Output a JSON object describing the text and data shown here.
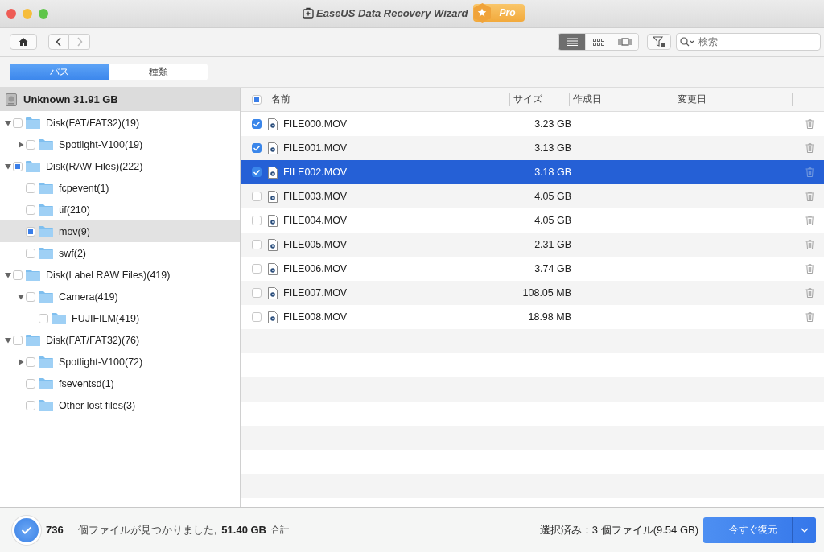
{
  "window": {
    "title": "EaseUS Data Recovery Wizard",
    "badge": "Pro"
  },
  "toolbar": {
    "views": [
      {
        "kind": "list",
        "selected": true
      },
      {
        "kind": "grid",
        "selected": false
      },
      {
        "kind": "cover",
        "selected": false
      }
    ],
    "search": {
      "placeholder": "検索"
    }
  },
  "tabs": [
    {
      "label": "パス",
      "selected": true
    },
    {
      "label": "種類",
      "selected": false
    }
  ],
  "drive": {
    "label": "Unknown 31.91 GB"
  },
  "tree": [
    {
      "label": "Disk(FAT/FAT32)(19)",
      "expanded": true,
      "partial": false,
      "selected": false,
      "children": [
        {
          "label": "Spotlight-V100(19)",
          "expanded": false,
          "partial": false,
          "selected": false
        }
      ]
    },
    {
      "label": "Disk(RAW Files)(222)",
      "expanded": true,
      "partial": true,
      "selected": false,
      "children": [
        {
          "label": "fcpevent(1)",
          "partial": false,
          "selected": false
        },
        {
          "label": "tif(210)",
          "partial": false,
          "selected": false
        },
        {
          "label": "mov(9)",
          "partial": true,
          "selected": true
        },
        {
          "label": "swf(2)",
          "partial": false,
          "selected": false
        }
      ]
    },
    {
      "label": "Disk(Label RAW Files)(419)",
      "expanded": true,
      "partial": false,
      "selected": false,
      "children": [
        {
          "label": "Camera(419)",
          "expanded": true,
          "partial": false,
          "selected": false,
          "children": [
            {
              "label": "FUJIFILM(419)",
              "partial": false,
              "selected": false
            }
          ]
        }
      ]
    },
    {
      "label": "Disk(FAT/FAT32)(76)",
      "expanded": true,
      "partial": false,
      "selected": false,
      "children": [
        {
          "label": "Spotlight-V100(72)",
          "expanded": false,
          "partial": false,
          "selected": false
        },
        {
          "label": "fseventsd(1)",
          "partial": false,
          "selected": false
        },
        {
          "label": "Other lost files(3)",
          "partial": false,
          "selected": false
        }
      ]
    }
  ],
  "table": {
    "select_all_partial": true,
    "columns": [
      "名前",
      "サイズ",
      "作成日",
      "変更日"
    ],
    "rows": [
      {
        "name": "FILE000.MOV",
        "size": "3.23 GB",
        "checked": true,
        "selected": false
      },
      {
        "name": "FILE001.MOV",
        "size": "3.13 GB",
        "checked": true,
        "selected": false
      },
      {
        "name": "FILE002.MOV",
        "size": "3.18 GB",
        "checked": true,
        "selected": true
      },
      {
        "name": "FILE003.MOV",
        "size": "4.05 GB",
        "checked": false,
        "selected": false
      },
      {
        "name": "FILE004.MOV",
        "size": "4.05 GB",
        "checked": false,
        "selected": false
      },
      {
        "name": "FILE005.MOV",
        "size": "2.31 GB",
        "checked": false,
        "selected": false
      },
      {
        "name": "FILE006.MOV",
        "size": "3.74 GB",
        "checked": false,
        "selected": false
      },
      {
        "name": "FILE007.MOV",
        "size": "108.05 MB",
        "checked": false,
        "selected": false
      },
      {
        "name": "FILE008.MOV",
        "size": "18.98 MB",
        "checked": false,
        "selected": false
      }
    ]
  },
  "status_bar": {
    "count": "736",
    "found_text": "個ファイルが見つかりました,",
    "total": "51.40 GB",
    "total_label": "合計",
    "selection": "選択済み：3 個ファイル(9.54 GB)",
    "recover_button": "今すぐ復元"
  }
}
